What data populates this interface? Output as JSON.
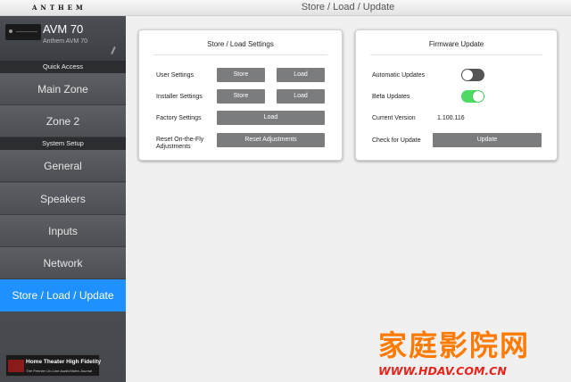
{
  "brand": "ANTHEM",
  "header": {
    "title": "Store / Load / Update"
  },
  "device": {
    "name": "AVM 70",
    "model": "Anthem AVM 70"
  },
  "sidebar": {
    "quick_access_label": "Quick Access",
    "system_setup_label": "System Setup",
    "items": [
      {
        "label": "Main Zone"
      },
      {
        "label": "Zone 2"
      },
      {
        "label": "General"
      },
      {
        "label": "Speakers"
      },
      {
        "label": "Inputs"
      },
      {
        "label": "Network"
      },
      {
        "label": "Store / Load / Update",
        "active": true
      }
    ],
    "logo": {
      "title": "Home Theater High Fidelity",
      "tagline": "The Premier On-Line Audio/Video Journal"
    }
  },
  "store_card": {
    "title": "Store / Load Settings",
    "rows": {
      "user": {
        "label": "User Settings",
        "store": "Store",
        "load": "Load"
      },
      "installer": {
        "label": "Installer Settings",
        "store": "Store",
        "load": "Load"
      },
      "factory": {
        "label": "Factory Settings",
        "load": "Load"
      },
      "reset": {
        "label_line1": "Reset On-the-Fly",
        "label_line2": "Adjustments",
        "button": "Reset Adjustments"
      }
    }
  },
  "firmware_card": {
    "title": "Firmware Update",
    "automatic_updates": {
      "label": "Automatic Updates",
      "enabled": false
    },
    "beta_updates": {
      "label": "Beta Updates",
      "enabled": true
    },
    "current_version": {
      "label": "Current Version",
      "value": "1.100.116"
    },
    "check_update": {
      "label": "Check for Update",
      "button": "Update"
    }
  },
  "colors": {
    "accent": "#1e90ff",
    "toggle_on": "#4cd964",
    "toggle_off": "#555555",
    "button": "#7b7c7e"
  },
  "watermark": {
    "title": "家庭影院网",
    "url": "WWW.HDAV.COM.CN"
  }
}
